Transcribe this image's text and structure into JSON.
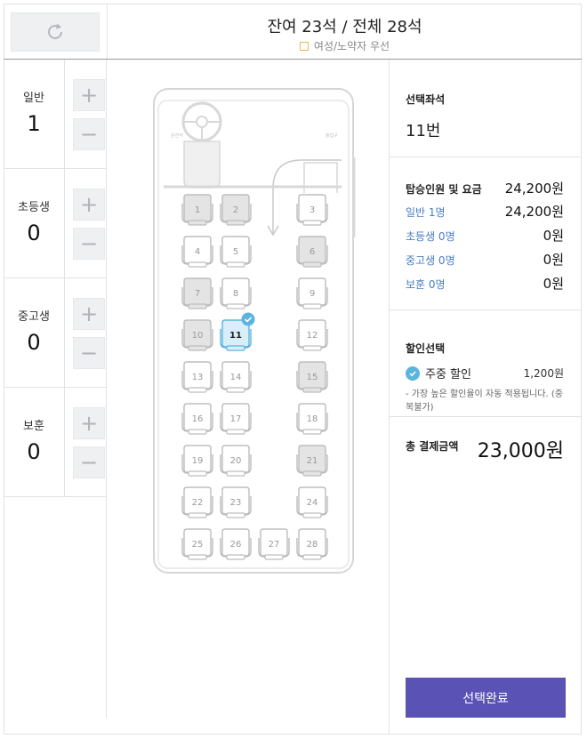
{
  "header": {
    "title": "잔여 23석 / 전체 28석",
    "legend_label": "여성/노약자 우선",
    "legend_color": "#f0b84a"
  },
  "passengers": [
    {
      "label": "일반",
      "count": "1"
    },
    {
      "label": "초등생",
      "count": "0"
    },
    {
      "label": "중고생",
      "count": "0"
    },
    {
      "label": "보훈",
      "count": "0"
    }
  ],
  "stepper": {
    "plus": "+",
    "minus": "−"
  },
  "bus": {
    "driver_label": "운전석",
    "door_label": "출입구",
    "seats": [
      {
        "n": "1",
        "state": "taken"
      },
      {
        "n": "2",
        "state": "taken"
      },
      {
        "n": "3",
        "state": "available"
      },
      {
        "n": "4",
        "state": "available"
      },
      {
        "n": "5",
        "state": "available"
      },
      {
        "n": "6",
        "state": "taken"
      },
      {
        "n": "7",
        "state": "taken"
      },
      {
        "n": "8",
        "state": "available"
      },
      {
        "n": "9",
        "state": "available"
      },
      {
        "n": "10",
        "state": "taken"
      },
      {
        "n": "11",
        "state": "selected"
      },
      {
        "n": "12",
        "state": "available"
      },
      {
        "n": "13",
        "state": "available"
      },
      {
        "n": "14",
        "state": "available"
      },
      {
        "n": "15",
        "state": "taken"
      },
      {
        "n": "16",
        "state": "available"
      },
      {
        "n": "17",
        "state": "available"
      },
      {
        "n": "18",
        "state": "available"
      },
      {
        "n": "19",
        "state": "available"
      },
      {
        "n": "20",
        "state": "available"
      },
      {
        "n": "21",
        "state": "taken"
      },
      {
        "n": "22",
        "state": "available"
      },
      {
        "n": "23",
        "state": "available"
      },
      {
        "n": "24",
        "state": "available"
      },
      {
        "n": "25",
        "state": "available"
      },
      {
        "n": "26",
        "state": "available"
      },
      {
        "n": "27",
        "state": "available"
      },
      {
        "n": "28",
        "state": "available"
      }
    ]
  },
  "summary": {
    "selected_seat_label": "선택좌석",
    "selected_seat_value": "11번",
    "fare_header_label": "탑승인원 및 요금",
    "fare_header_value": "24,200원",
    "fare_rows": [
      {
        "label": "일반 1명",
        "value": "24,200원"
      },
      {
        "label": "초등생 0명",
        "value": "0원"
      },
      {
        "label": "중고생 0명",
        "value": "0원"
      },
      {
        "label": "보훈 0명",
        "value": "0원"
      }
    ],
    "discount_label": "할인선택",
    "discount_option": "주중 할인",
    "discount_amount": "1,200원",
    "discount_note": "- 가장 높은 할인율이 자동 적용됩니다. (중복불가)",
    "total_label": "총 결제금액",
    "total_value": "23,000원",
    "confirm_label": "선택완료"
  },
  "colors": {
    "accent": "#5b52b6",
    "selected_seat": "#5ab4de",
    "fare_label": "#4a7dc4"
  }
}
